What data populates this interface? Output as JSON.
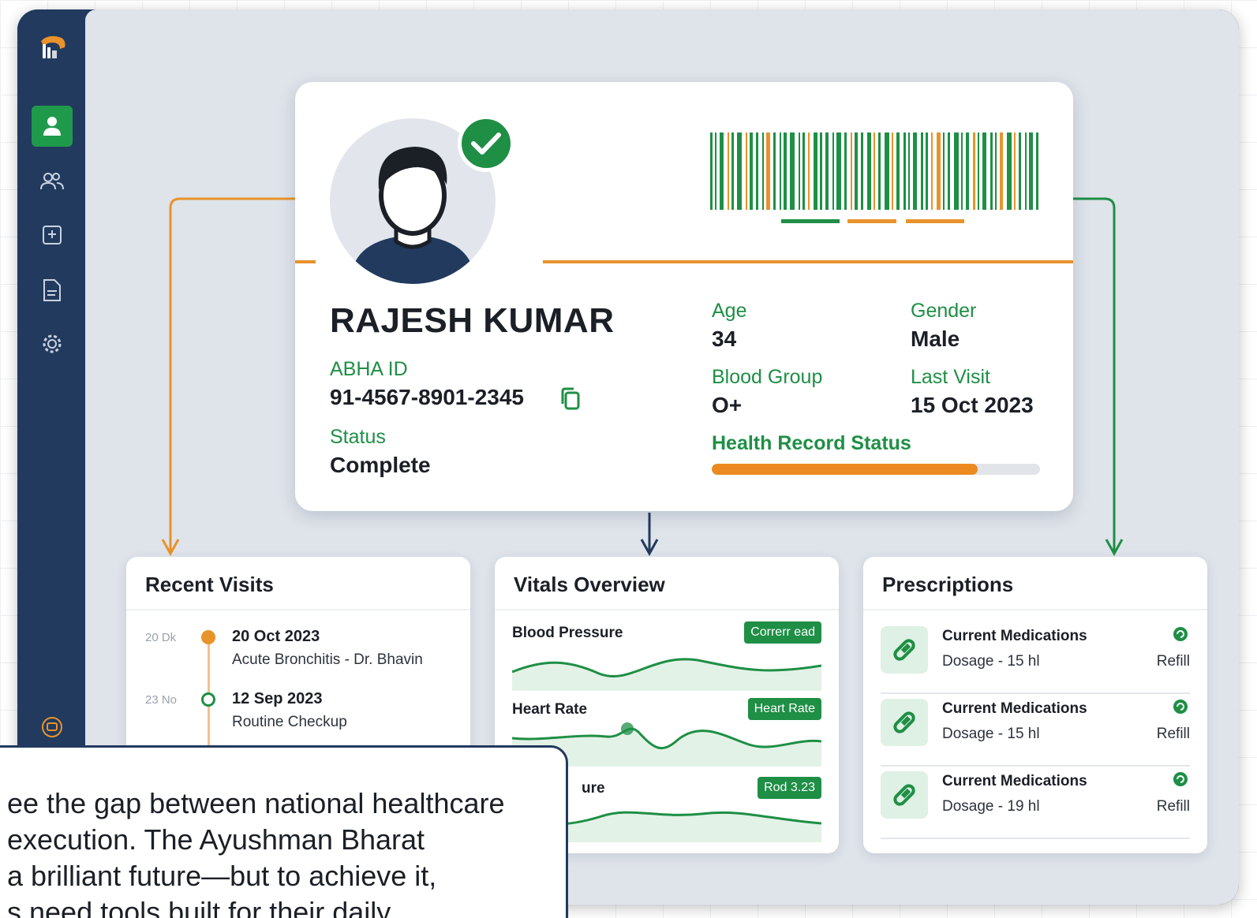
{
  "sidebar": {
    "logo_icon": "hospital-logo-icon",
    "items": [
      {
        "icon": "user-icon",
        "active": true
      },
      {
        "icon": "users-icon",
        "active": false
      },
      {
        "icon": "clipboard-icon",
        "active": false
      },
      {
        "icon": "document-icon",
        "active": false
      },
      {
        "icon": "gear-icon",
        "active": false
      }
    ],
    "bottom_icon": "support-icon"
  },
  "patient_card": {
    "name": "RAJESH KUMAR",
    "abha_label": "ABHA ID",
    "abha_value": "91-4567-8901-2345",
    "status_label": "Status",
    "status_value": "Complete",
    "age_label": "Age",
    "age_value": "34",
    "gender_label": "Gender",
    "gender_value": "Male",
    "blood_label": "Blood Group",
    "blood_value": "O+",
    "last_visit_label": "Last Visit",
    "last_visit_value": "15 Oct 2023",
    "record_status_label": "Health Record Status",
    "record_status_progress": 0.81
  },
  "recent_visits": {
    "title": "Recent Visits",
    "items": [
      {
        "short": "20 Dk",
        "date": "20 Oct 2023",
        "desc": "Acute Bronchitis - Dr. Bhavin"
      },
      {
        "short": "23 No",
        "date": "12 Sep 2023",
        "desc": "Routine Checkup"
      }
    ]
  },
  "vitals": {
    "title": "Vitals Overview",
    "items": [
      {
        "name": "Blood Pressure",
        "tag": "Correrr ead"
      },
      {
        "name": "Heart Rate",
        "tag": "Heart Rate"
      },
      {
        "name": "ure",
        "tag": "Rod 3.23"
      }
    ]
  },
  "prescriptions": {
    "title": "Prescriptions",
    "items": [
      {
        "name": "Current Medications",
        "dose": "Dosage - 15 hl",
        "action": "Refill"
      },
      {
        "name": "Current Medications",
        "dose": "Dosage - 15 hl",
        "action": "Refill"
      },
      {
        "name": "Current Medications",
        "dose": "Dosage - 19 hl",
        "action": "Refill"
      }
    ]
  },
  "quote": {
    "line1": "ee the gap between national healthcare",
    "line2": "execution. The Ayushman Bharat",
    "line3": "a brilliant future—but to achieve it,",
    "line4": "s need tools built for their daily"
  },
  "colors": {
    "sidebar": "#223a5e",
    "accent_green": "#1e8f45",
    "accent_orange": "#e8932b",
    "panel_bg": "#dfe3ea"
  }
}
